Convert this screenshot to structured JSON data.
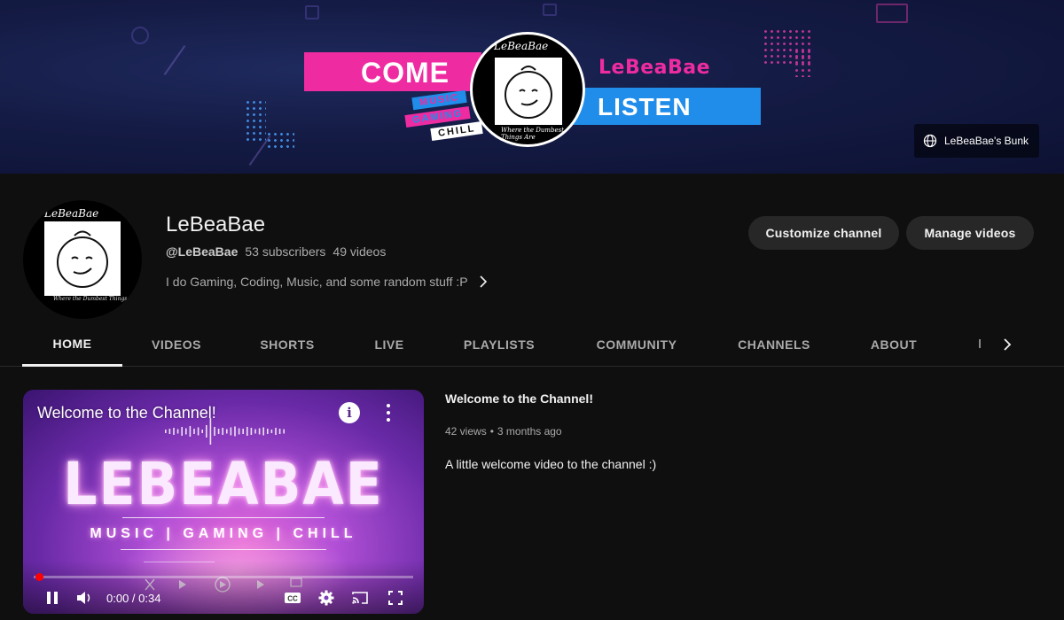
{
  "banner": {
    "headline_left": "COME",
    "headline_right": "LISTEN",
    "brand": "LeBeaBae",
    "tags": [
      "MUSIC",
      "GAMING",
      "CHILL"
    ],
    "logo_top": "LeBeaBae",
    "logo_bottom": "Where the Dumbest Things Are",
    "link_label": "LeBeaBae's Bunk"
  },
  "channel": {
    "name": "LeBeaBae",
    "handle": "@LeBeaBae",
    "subscribers": "53 subscribers",
    "videos": "49 videos",
    "description": "I do Gaming, Coding, Music, and some random stuff :P",
    "avatar_top": "LeBeaBae",
    "avatar_bottom": "Where the Dumbest Things Are"
  },
  "actions": {
    "customize": "Customize channel",
    "manage": "Manage videos"
  },
  "tabs": [
    "HOME",
    "VIDEOS",
    "SHORTS",
    "LIVE",
    "PLAYLISTS",
    "COMMUNITY",
    "CHANNELS",
    "ABOUT"
  ],
  "active_tab": "HOME",
  "featured": {
    "player_title": "Welcome to the Channel!",
    "brand": "LEBEABAE",
    "brand_sub": "MUSIC | GAMING | CHILL",
    "time": "0:00 / 0:34",
    "progress": 0.0,
    "title": "Welcome to the Channel!",
    "views": "42 views",
    "age": "3 months ago",
    "description": "A little welcome video to the channel :)"
  },
  "icons": {
    "globe": "globe-icon",
    "chevron": "chevron-right-icon",
    "info": "info-icon",
    "more": "more-vert-icon",
    "play": "pause-icon",
    "volume": "volume-icon",
    "cc": "closed-captions-icon",
    "settings": "settings-gear-icon",
    "cast": "cast-icon",
    "fullscreen": "fullscreen-icon"
  },
  "colors": {
    "background": "#0f0f0f",
    "accent_pink": "#ef2ba2",
    "accent_blue": "#1f8de9",
    "progress_red": "#ff0000",
    "button_bg": "#272727"
  }
}
